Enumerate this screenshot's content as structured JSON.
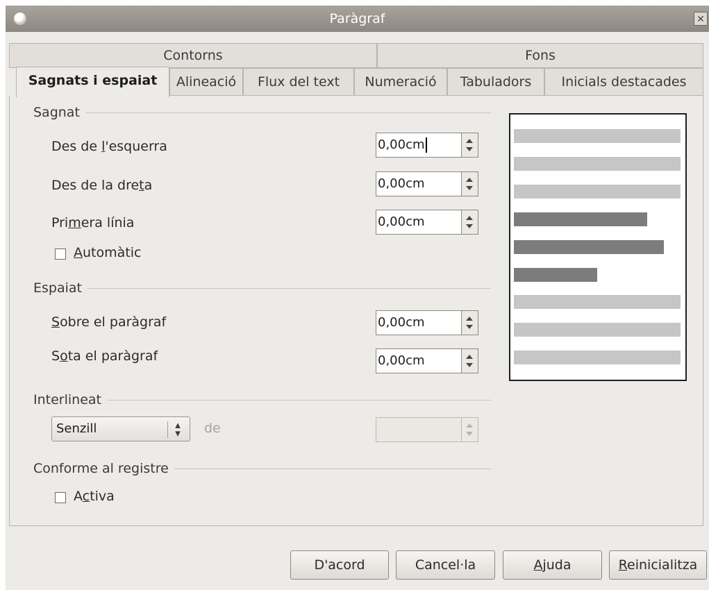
{
  "window": {
    "title": "Paràgraf",
    "close_glyph": "✕"
  },
  "tabs_row1": [
    {
      "label": "Contorns"
    },
    {
      "label": "Fons"
    }
  ],
  "tabs_row2": [
    {
      "label": "Sagnats i espaiat",
      "active": true
    },
    {
      "label": "Alineació"
    },
    {
      "label": "Flux del text"
    },
    {
      "label": "Numeració"
    },
    {
      "label": "Tabuladors"
    },
    {
      "label": "Inicials destacades"
    }
  ],
  "sagnat": {
    "heading": "Sagnat",
    "left": {
      "label_pre": "Des de ",
      "label_u": "l",
      "label_post": "'esquerra",
      "value": "0,00cm"
    },
    "right": {
      "label_pre": "Des de la dre",
      "label_u": "t",
      "label_post": "a",
      "value": "0,00cm"
    },
    "first": {
      "label_pre": "Pri",
      "label_u": "m",
      "label_post": "era línia",
      "value": "0,00cm"
    },
    "auto": {
      "label_u": "A",
      "label_post": "utomàtic",
      "checked": false
    }
  },
  "espaiat": {
    "heading": "Espaiat",
    "above": {
      "label_u": "S",
      "label_post": "obre el paràgraf",
      "value": "0,00cm"
    },
    "below": {
      "label_pre": "S",
      "label_u": "o",
      "label_post": "ta el paràgraf",
      "value": "0,00cm"
    }
  },
  "interlineat": {
    "heading": "Interlineat",
    "mode": "Senzill",
    "of_label": "de",
    "of_value": ""
  },
  "registre": {
    "heading": "Conforme al registre",
    "active": {
      "label_pre": "A",
      "label_u": "c",
      "label_post": "tiva",
      "checked": false
    }
  },
  "buttons": {
    "ok": "D'acord",
    "cancel": "Cancel·la",
    "help_u": "A",
    "help_post": "juda",
    "reset_u": "R",
    "reset_post": "einicialitza"
  },
  "icons": {
    "app": "app-logo-icon",
    "close": "close-icon",
    "spin": "spin-arrows-icon",
    "combo": "updown-icon"
  }
}
